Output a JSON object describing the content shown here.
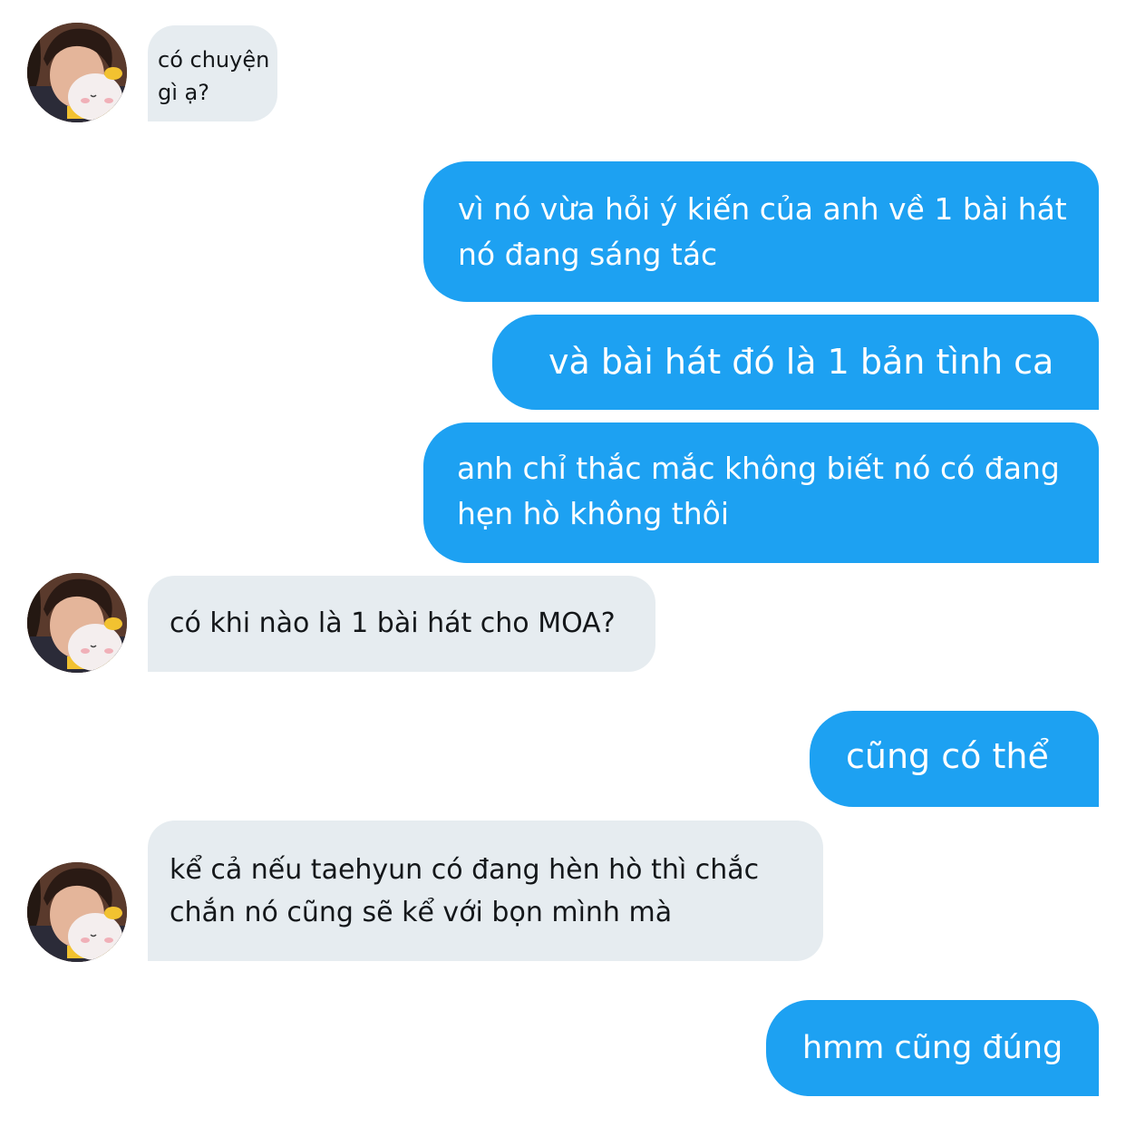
{
  "colors": {
    "incoming_bubble": "#e6ecf0",
    "outgoing_bubble": "#1da1f2",
    "incoming_text": "#14171a",
    "outgoing_text": "#ffffff"
  },
  "avatar": {
    "icon": "user-avatar-photo"
  },
  "messages": [
    {
      "direction": "incoming",
      "text": "có chuyện\ngì ạ?"
    },
    {
      "direction": "outgoing",
      "text": "vì nó vừa hỏi ý kiến của anh về 1 bài hát\nnó đang sáng tác"
    },
    {
      "direction": "outgoing",
      "text": "và bài hát đó là 1 bản tình ca"
    },
    {
      "direction": "outgoing",
      "text": "anh chỉ thắc mắc không biết nó có đang\nhẹn hò không thôi"
    },
    {
      "direction": "incoming",
      "text": "có khi nào là 1 bài hát cho MOA?"
    },
    {
      "direction": "outgoing",
      "text": "cũng có thể"
    },
    {
      "direction": "incoming",
      "text": "kể cả nếu taehyun có đang hèn hò thì chắc\nchắn nó cũng sẽ kể với bọn mình mà"
    },
    {
      "direction": "outgoing",
      "text": "hmm cũng đúng"
    }
  ]
}
